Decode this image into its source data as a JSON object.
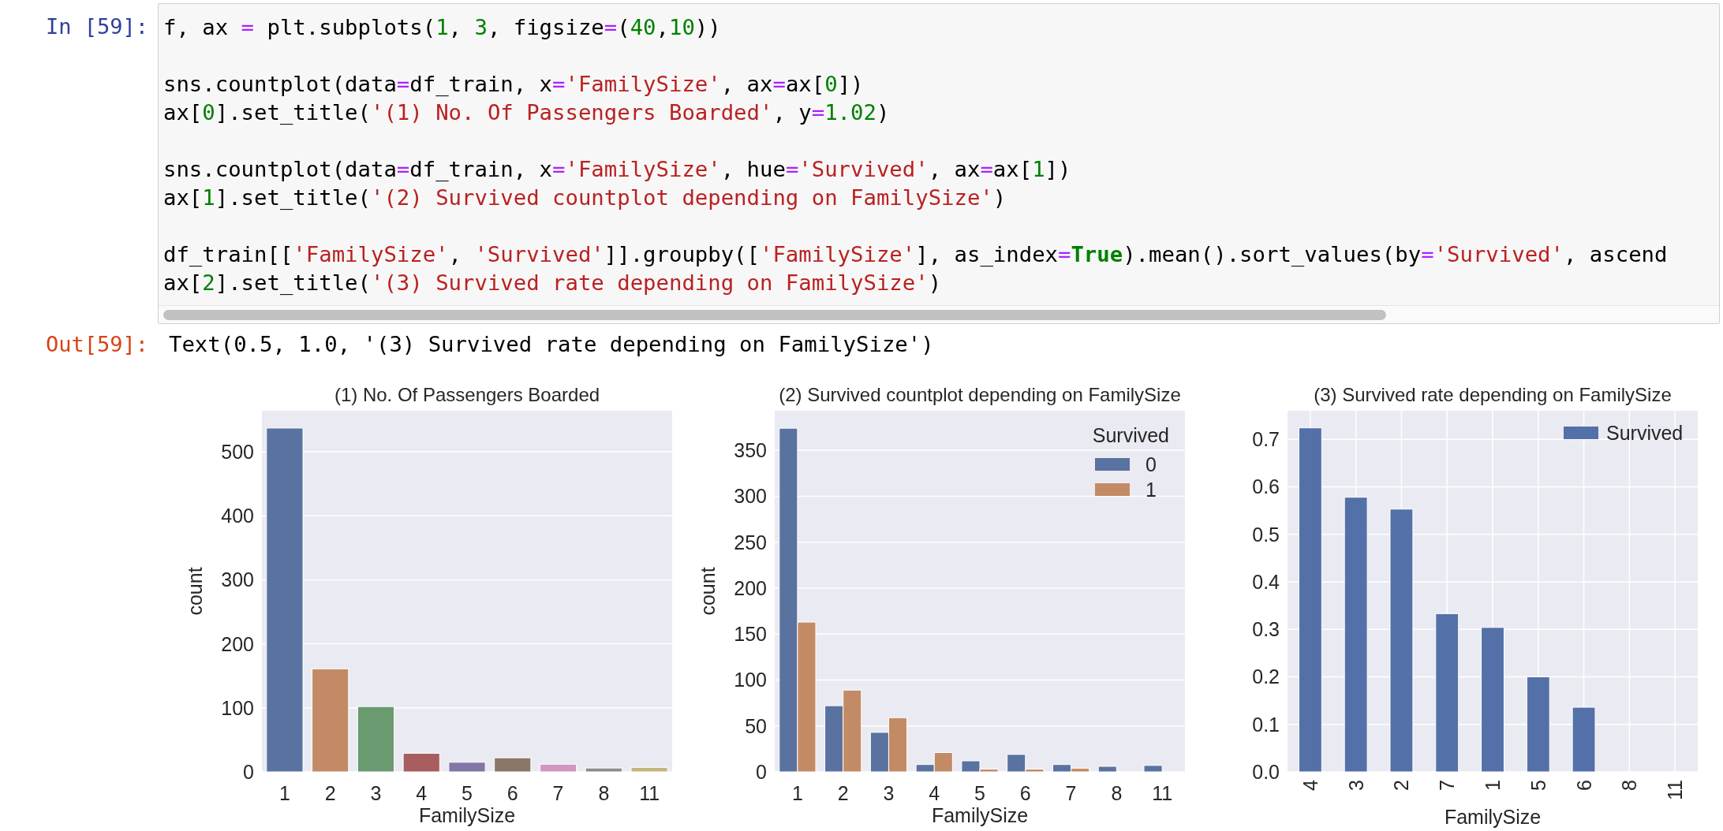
{
  "input_cell": {
    "prompt": "In [59]:",
    "code_blocks": [
      [
        [
          {
            "kind": "plain",
            "text": "f, ax "
          },
          {
            "kind": "op",
            "text": "="
          },
          {
            "kind": "plain",
            "text": " plt.subplots("
          },
          {
            "kind": "num",
            "text": "1"
          },
          {
            "kind": "plain",
            "text": ", "
          },
          {
            "kind": "num",
            "text": "3"
          },
          {
            "kind": "plain",
            "text": ", figsize"
          },
          {
            "kind": "op",
            "text": "="
          },
          {
            "kind": "plain",
            "text": "("
          },
          {
            "kind": "num",
            "text": "40"
          },
          {
            "kind": "plain",
            "text": ","
          },
          {
            "kind": "num",
            "text": "10"
          },
          {
            "kind": "plain",
            "text": "))"
          }
        ]
      ],
      [
        [
          {
            "kind": "plain",
            "text": "sns.countplot(data"
          },
          {
            "kind": "op",
            "text": "="
          },
          {
            "kind": "plain",
            "text": "df_train, x"
          },
          {
            "kind": "op",
            "text": "="
          },
          {
            "kind": "str",
            "text": "'FamilySize'"
          },
          {
            "kind": "plain",
            "text": ", ax"
          },
          {
            "kind": "op",
            "text": "="
          },
          {
            "kind": "plain",
            "text": "ax["
          },
          {
            "kind": "num",
            "text": "0"
          },
          {
            "kind": "plain",
            "text": "])"
          }
        ],
        [
          {
            "kind": "plain",
            "text": "ax["
          },
          {
            "kind": "num",
            "text": "0"
          },
          {
            "kind": "plain",
            "text": "].set_title("
          },
          {
            "kind": "str",
            "text": "'(1) No. Of Passengers Boarded'"
          },
          {
            "kind": "plain",
            "text": ", y"
          },
          {
            "kind": "op",
            "text": "="
          },
          {
            "kind": "num",
            "text": "1.02"
          },
          {
            "kind": "plain",
            "text": ")"
          }
        ]
      ],
      [
        [
          {
            "kind": "plain",
            "text": "sns.countplot(data"
          },
          {
            "kind": "op",
            "text": "="
          },
          {
            "kind": "plain",
            "text": "df_train, x"
          },
          {
            "kind": "op",
            "text": "="
          },
          {
            "kind": "str",
            "text": "'FamilySize'"
          },
          {
            "kind": "plain",
            "text": ", hue"
          },
          {
            "kind": "op",
            "text": "="
          },
          {
            "kind": "str",
            "text": "'Survived'"
          },
          {
            "kind": "plain",
            "text": ", ax"
          },
          {
            "kind": "op",
            "text": "="
          },
          {
            "kind": "plain",
            "text": "ax["
          },
          {
            "kind": "num",
            "text": "1"
          },
          {
            "kind": "plain",
            "text": "])"
          }
        ],
        [
          {
            "kind": "plain",
            "text": "ax["
          },
          {
            "kind": "num",
            "text": "1"
          },
          {
            "kind": "plain",
            "text": "].set_title("
          },
          {
            "kind": "str",
            "text": "'(2) Survived countplot depending on FamilySize'"
          },
          {
            "kind": "plain",
            "text": ")"
          }
        ]
      ],
      [
        [
          {
            "kind": "plain",
            "text": "df_train[["
          },
          {
            "kind": "str",
            "text": "'FamilySize'"
          },
          {
            "kind": "plain",
            "text": ", "
          },
          {
            "kind": "str",
            "text": "'Survived'"
          },
          {
            "kind": "plain",
            "text": "]].groupby(["
          },
          {
            "kind": "str",
            "text": "'FamilySize'"
          },
          {
            "kind": "plain",
            "text": "], as_index"
          },
          {
            "kind": "op",
            "text": "="
          },
          {
            "kind": "kw",
            "text": "True"
          },
          {
            "kind": "plain",
            "text": ").mean().sort_values(by"
          },
          {
            "kind": "op",
            "text": "="
          },
          {
            "kind": "str",
            "text": "'Survived'"
          },
          {
            "kind": "plain",
            "text": ", ascend"
          }
        ],
        [
          {
            "kind": "plain",
            "text": "ax["
          },
          {
            "kind": "num",
            "text": "2"
          },
          {
            "kind": "plain",
            "text": "].set_title("
          },
          {
            "kind": "str",
            "text": "'(3) Survived rate depending on FamilySize'"
          },
          {
            "kind": "plain",
            "text": ")"
          }
        ]
      ]
    ]
  },
  "output_cell": {
    "prompt": "Out[59]:",
    "text": "Text(0.5, 1.0, '(3) Survived rate depending on FamilySize')"
  },
  "figures": [
    {
      "xtick_labels_vertical": false,
      "chart_data": {
        "type": "bar",
        "title": "(1) No. Of Passengers Boarded",
        "xlabel": "FamilySize",
        "ylabel": "count",
        "categories": [
          "1",
          "2",
          "3",
          "4",
          "5",
          "6",
          "7",
          "8",
          "11"
        ],
        "ylim": [
          0,
          564
        ],
        "yticks": [
          0,
          100,
          200,
          300,
          400,
          500
        ],
        "grid": "y",
        "series": [
          {
            "values": [
              537,
              161,
              102,
              29,
              15,
              22,
              12,
              6,
              7
            ],
            "colors": [
              "#5a72a0",
              "#c38b65",
              "#6a9a70",
              "#a85e5f",
              "#8276a6",
              "#8a7766",
              "#cf97c2",
              "#8c8c8c",
              "#c4b67c"
            ]
          }
        ]
      }
    },
    {
      "xtick_labels_vertical": false,
      "chart_data": {
        "type": "bar",
        "title": "(2) Survived countplot depending on FamilySize",
        "xlabel": "FamilySize",
        "ylabel": "count",
        "categories": [
          "1",
          "2",
          "3",
          "4",
          "5",
          "6",
          "7",
          "8",
          "11"
        ],
        "ylim": [
          0,
          393
        ],
        "yticks": [
          0,
          50,
          100,
          150,
          200,
          250,
          300,
          350
        ],
        "grid": "y",
        "legend": {
          "title": "Survived"
        },
        "series": [
          {
            "name": "0",
            "color": "#5a72a0",
            "values": [
              374,
              72,
              43,
              8,
              12,
              19,
              8,
              6,
              7
            ]
          },
          {
            "name": "1",
            "color": "#c38b65",
            "values": [
              163,
              89,
              59,
              21,
              3,
              3,
              4,
              0,
              0
            ]
          }
        ]
      }
    },
    {
      "xtick_labels_vertical": true,
      "chart_data": {
        "type": "bar",
        "title": "(3) Survived rate depending on FamilySize",
        "xlabel": "FamilySize",
        "categories": [
          "4",
          "3",
          "2",
          "7",
          "1",
          "5",
          "6",
          "8",
          "11"
        ],
        "ylim": [
          0,
          0.76
        ],
        "yticks": [
          {
            "value": 0,
            "label": "0.0"
          },
          {
            "value": 0.1,
            "label": "0.1"
          },
          {
            "value": 0.2,
            "label": "0.2"
          },
          {
            "value": 0.3,
            "label": "0.3"
          },
          {
            "value": 0.4,
            "label": "0.4"
          },
          {
            "value": 0.5,
            "label": "0.5"
          },
          {
            "value": 0.6,
            "label": "0.6"
          },
          {
            "value": 0.7,
            "label": "0.7"
          }
        ],
        "grid": "both",
        "legend": true,
        "series": [
          {
            "name": "Survived",
            "color": "#5470a8",
            "values": [
              0.724,
              0.578,
              0.553,
              0.333,
              0.304,
              0.2,
              0.136,
              0,
              0
            ]
          }
        ]
      }
    }
  ]
}
